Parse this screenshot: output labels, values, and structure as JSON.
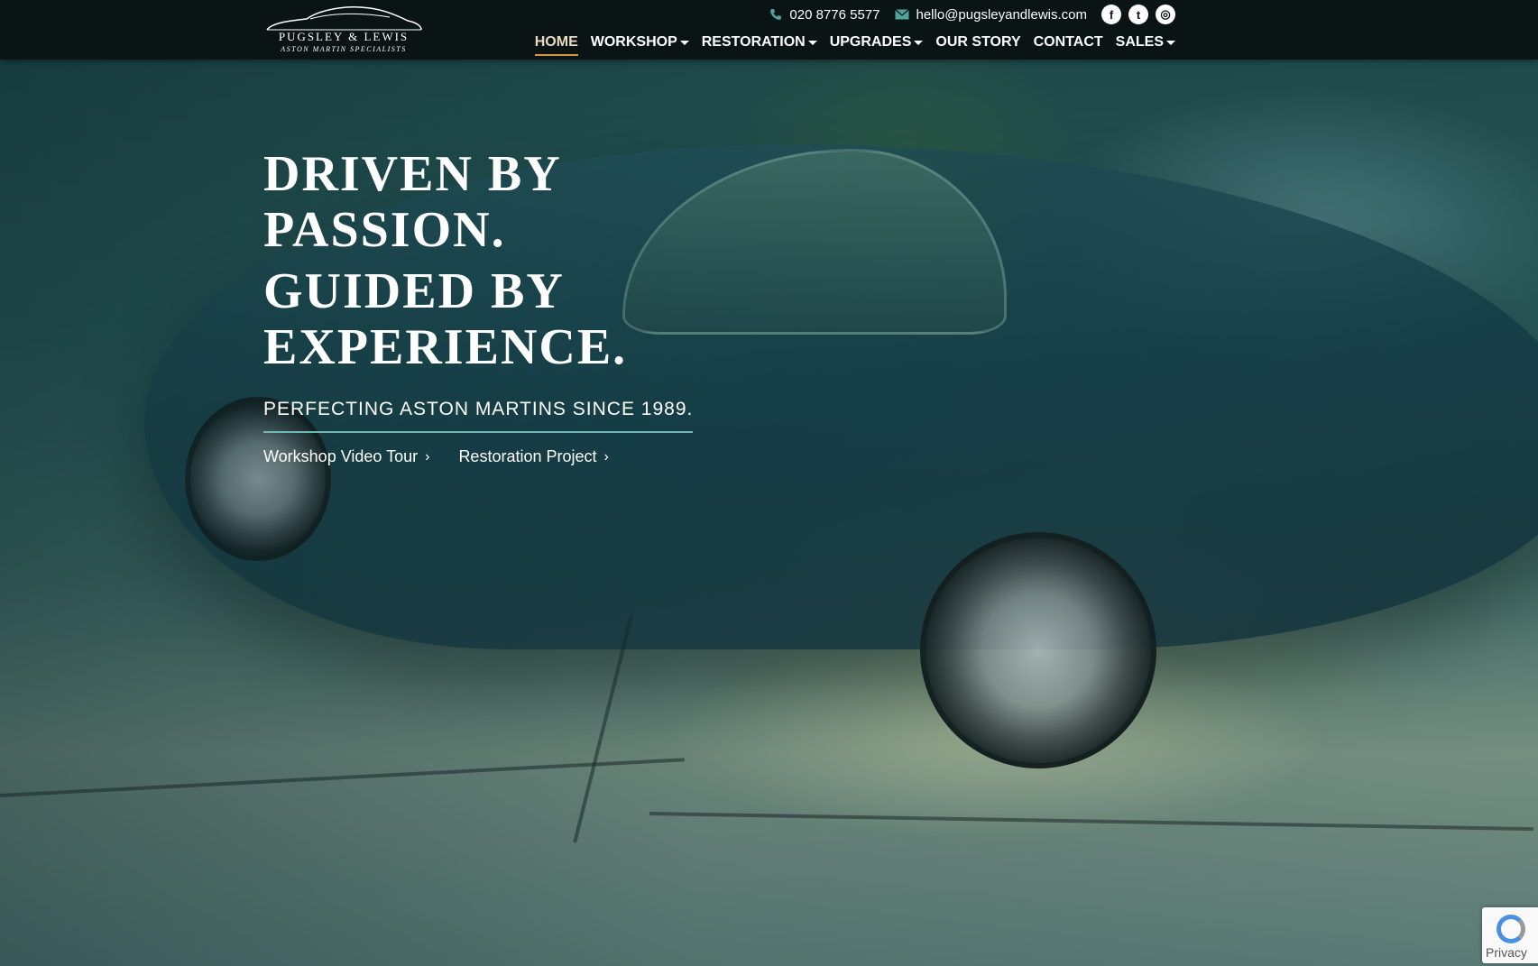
{
  "brand": {
    "name": "PUGSLEY & LEWIS",
    "tagline": "ASTON MARTIN SPECIALISTS"
  },
  "contact": {
    "phone": "020 8776 5577",
    "email": "hello@pugsleyandlewis.com",
    "phone_icon": "phone-icon",
    "email_icon": "envelope-icon"
  },
  "social": {
    "facebook": "f",
    "twitter": "t",
    "instagram": "◎"
  },
  "nav": {
    "home": "HOME",
    "workshop": "WORKSHOP",
    "restoration": "RESTORATION",
    "upgrades": "UPGRADES",
    "our_story": "OUR STORY",
    "contact": "CONTACT",
    "sales": "SALES"
  },
  "hero": {
    "headline_1": "DRIVEN BY PASSION.",
    "headline_2": "GUIDED BY EXPERIENCE.",
    "tagline": "PERFECTING ASTON MARTINS SINCE 1989.",
    "link_1": "Workshop Video Tour",
    "link_2": "Restoration Project",
    "chevron": "›"
  },
  "recaptcha": {
    "label": "Privacy"
  },
  "colors": {
    "header_bg": "#0b1414",
    "accent_underline": "#d39a3d",
    "tagline_rule": "#6fb8b0",
    "text": "#ffffff"
  }
}
